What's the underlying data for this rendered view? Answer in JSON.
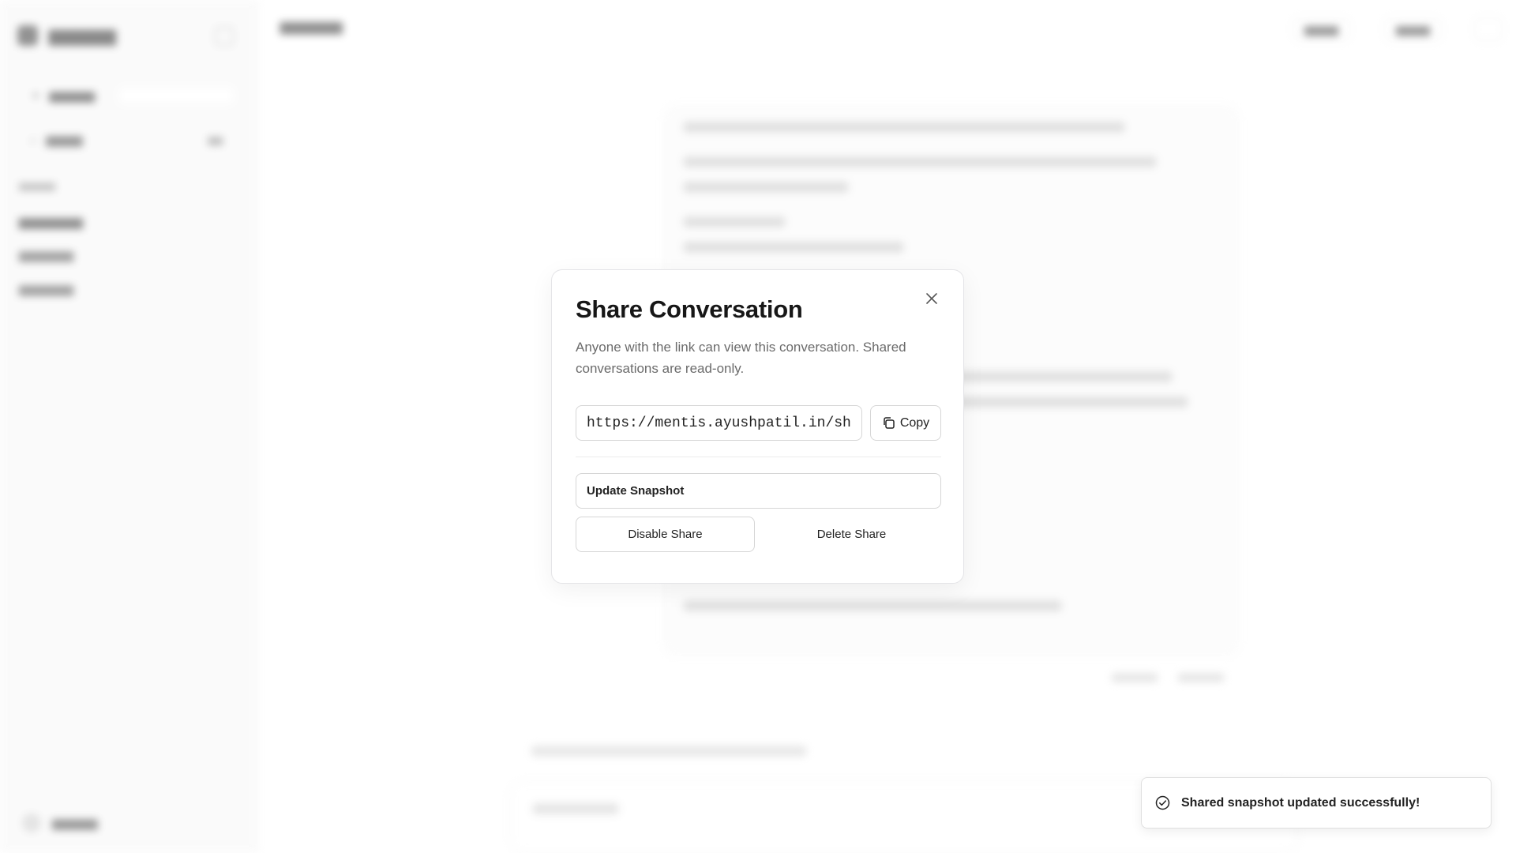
{
  "modal": {
    "title": "Share Conversation",
    "description": "Anyone with the link can view this conversation. Shared conversations are read-only.",
    "share_url": "https://mentis.ayushpatil.in/sha",
    "copy_label": "Copy",
    "update_label": "Update Snapshot",
    "disable_label": "Disable Share",
    "delete_label": "Delete Share",
    "close_icon": "close-icon",
    "copy_icon": "copy-icon"
  },
  "toast": {
    "message": "Shared snapshot updated successfully!",
    "icon": "check-circle-icon"
  }
}
